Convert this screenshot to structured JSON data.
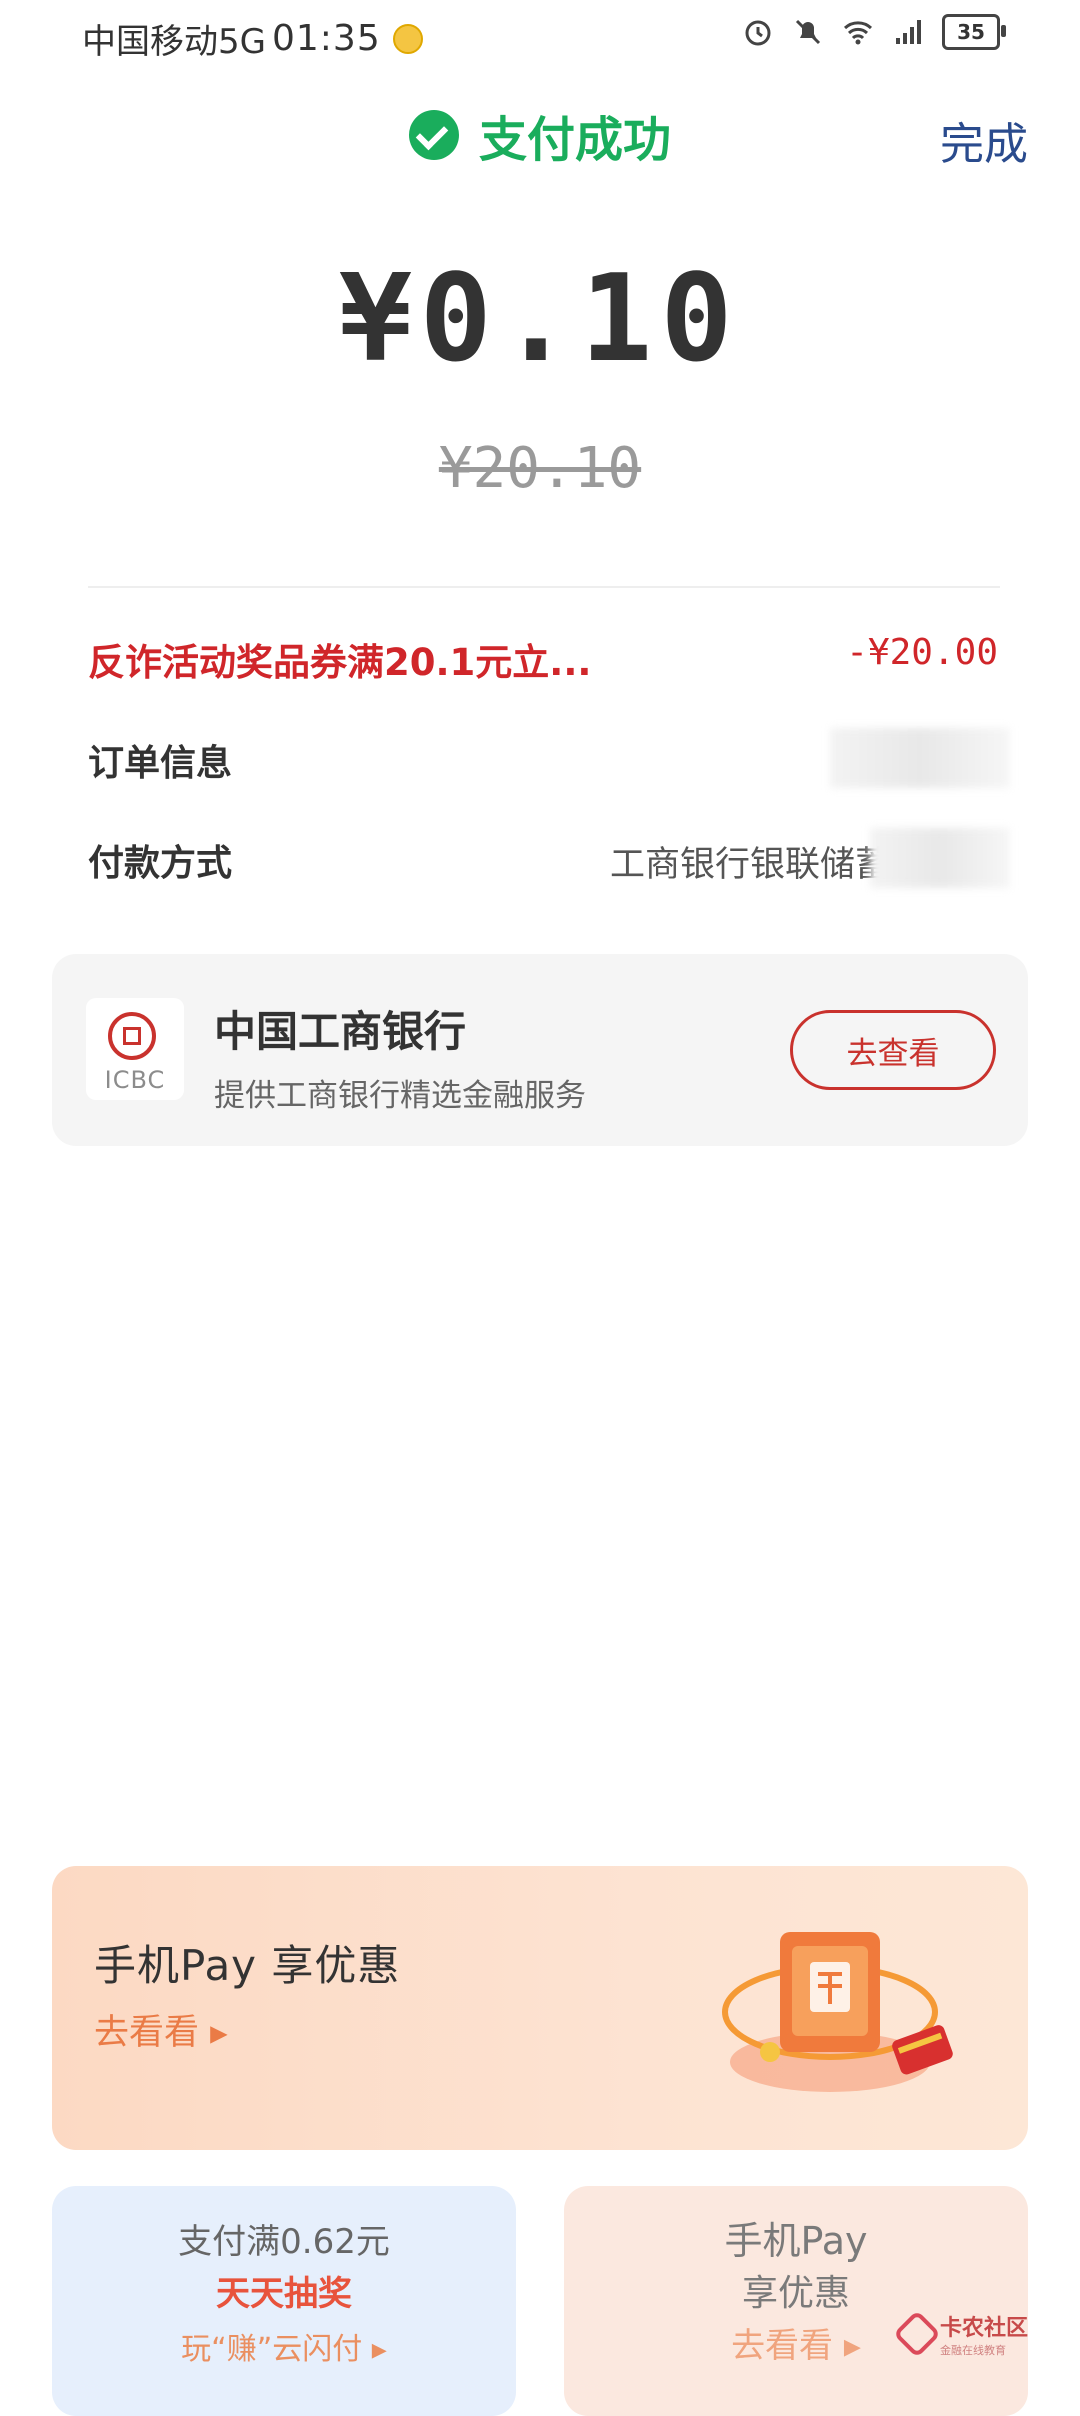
{
  "status_bar": {
    "carrier": "中国移动5G",
    "time": "01:35",
    "battery": "35",
    "network": "5G"
  },
  "header": {
    "title": "支付成功",
    "done_label": "完成"
  },
  "payment": {
    "amount": "¥0.10",
    "original_amount": "¥20.10"
  },
  "details": {
    "discount_label": "反诈活动奖品券满20.1元立...",
    "discount_value": "-¥20.00",
    "order_label": "订单信息",
    "payment_method_label": "付款方式",
    "payment_method_value": "工商银行银联储蓄卡「"
  },
  "bank": {
    "logo_text": "ICBC",
    "name": "中国工商银行",
    "description": "提供工商银行精选金融服务",
    "button_label": "去查看"
  },
  "promo_big": {
    "title": "手机Pay 享优惠",
    "link": "去看看 ▸"
  },
  "promo_left": {
    "line1": "支付满0.62元",
    "line2": "天天抽奖",
    "line3": "玩“赚”云闪付 ▸"
  },
  "promo_right": {
    "line1": "手机Pay",
    "line2": "享优惠",
    "line3": "去看看 ▸"
  },
  "watermark": {
    "main": "卡农社区",
    "sub": "金融在线教育"
  },
  "colors": {
    "success": "#1aad5c",
    "discount": "#d0262a",
    "bank_accent": "#c9322d",
    "done_link": "#2a4b8d"
  }
}
